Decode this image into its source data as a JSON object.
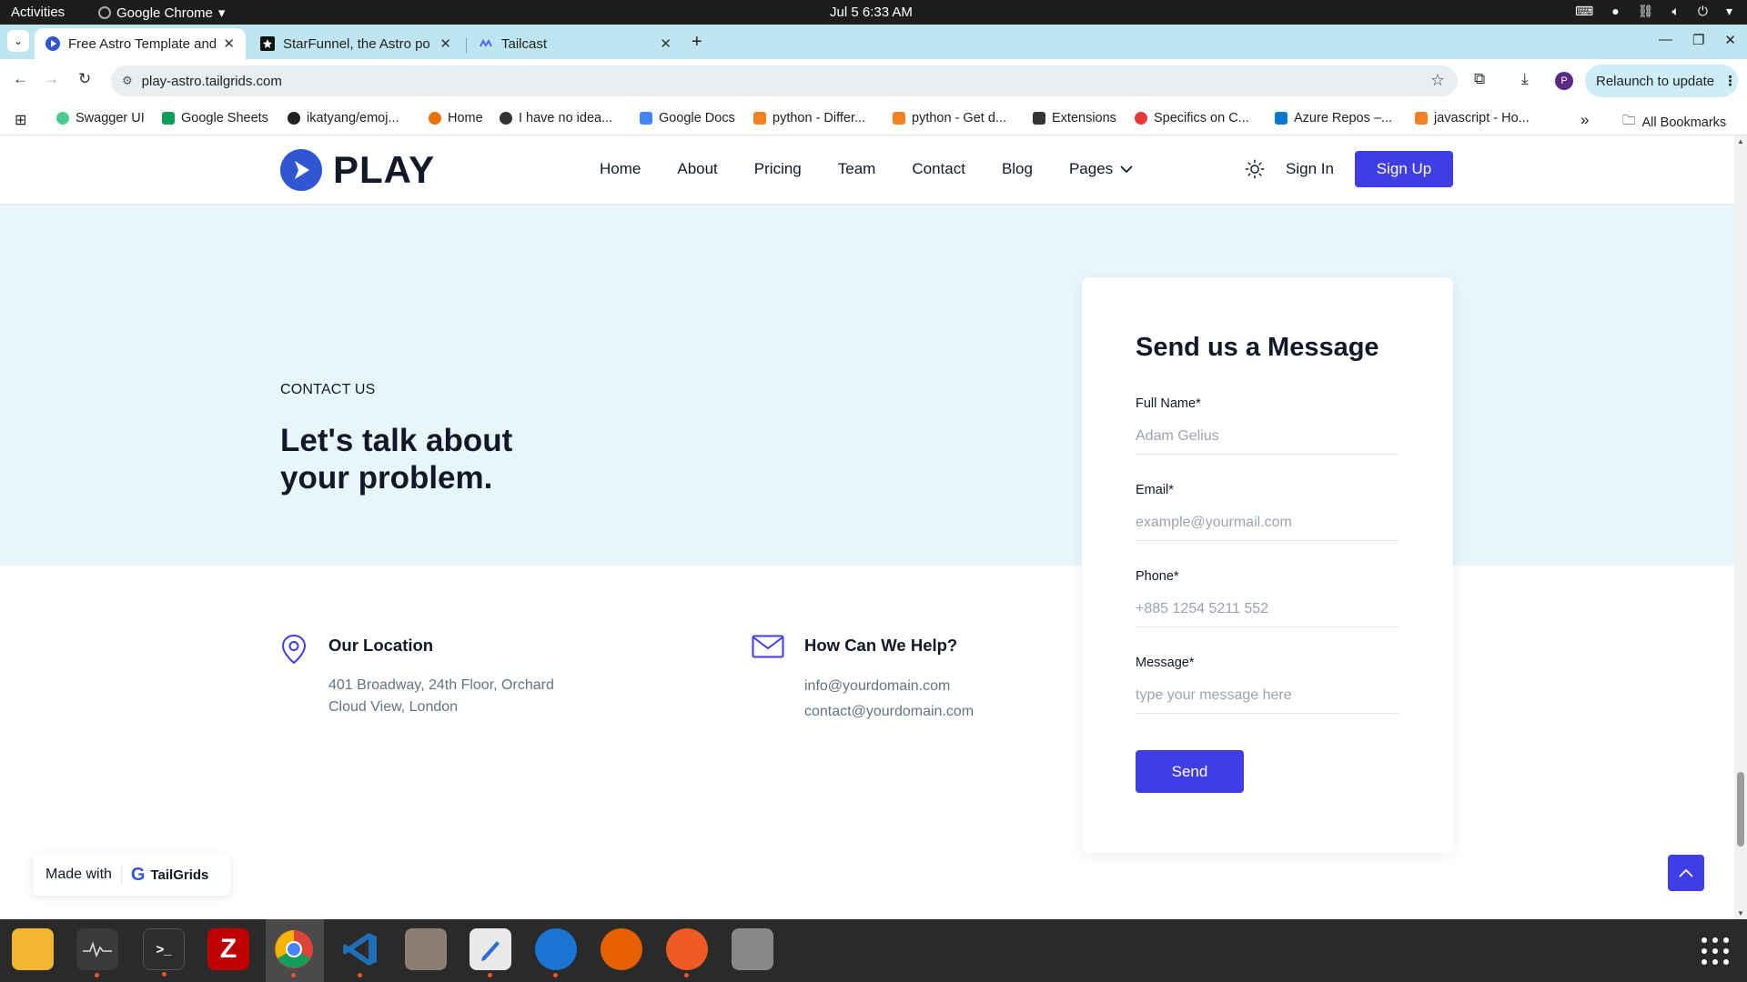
{
  "system_bar": {
    "activities": "Activities",
    "app_name": "Google Chrome",
    "clock": "Jul 5   6:33 AM"
  },
  "tabs": [
    {
      "title": "Free Astro Template and",
      "active": true
    },
    {
      "title": "StarFunnel, the Astro po",
      "active": false
    },
    {
      "title": "Tailcast",
      "active": false
    }
  ],
  "toolbar": {
    "url": "play-astro.tailgrids.com",
    "relaunch_label": "Relaunch to update",
    "profile_initial": "P"
  },
  "bookmarks": [
    {
      "label": "Swagger UI",
      "icon": "swagger-icon",
      "color": "#49cc90"
    },
    {
      "label": "Google Sheets",
      "icon": "sheets-icon",
      "color": "#0f9d58"
    },
    {
      "label": "ikatyang/emoj...",
      "icon": "github-icon",
      "color": "#222222"
    },
    {
      "label": "Home",
      "icon": "home-icon",
      "color": "#e8710a"
    },
    {
      "label": "I have no idea...",
      "icon": "globe-icon",
      "color": "#333333"
    },
    {
      "label": "Google Docs",
      "icon": "docs-icon",
      "color": "#4285f4"
    },
    {
      "label": "python - Differ...",
      "icon": "stackoverflow-icon",
      "color": "#f48024"
    },
    {
      "label": "python - Get d...",
      "icon": "stackoverflow-icon",
      "color": "#f48024"
    },
    {
      "label": "Extensions",
      "icon": "puzzle-icon",
      "color": "#333333"
    },
    {
      "label": "Specifics on C...",
      "icon": "asterisk-icon",
      "color": "#e53935"
    },
    {
      "label": "Azure Repos –...",
      "icon": "azure-icon",
      "color": "#0078d4"
    },
    {
      "label": "javascript - Ho...",
      "icon": "stackoverflow-icon",
      "color": "#f48024"
    }
  ],
  "bookmarks_overflow": "»",
  "all_bookmarks": "All Bookmarks",
  "site": {
    "logo_text": "PLAY",
    "nav": [
      "Home",
      "About",
      "Pricing",
      "Team",
      "Contact",
      "Blog",
      "Pages"
    ],
    "sign_in": "Sign In",
    "sign_up": "Sign Up",
    "accent_color": "#3f3de6"
  },
  "contact": {
    "eyebrow": "CONTACT US",
    "heading": "Let's talk about your problem.",
    "location": {
      "title": "Our Location",
      "line1": "401 Broadway, 24th Floor, Orchard",
      "line2": "Cloud View, London"
    },
    "help": {
      "title": "How Can We Help?",
      "email1": "info@yourdomain.com",
      "email2": "contact@yourdomain.com"
    }
  },
  "form": {
    "title": "Send us a Message",
    "full_name_label": "Full Name*",
    "full_name_placeholder": "Adam Gelius",
    "email_label": "Email*",
    "email_placeholder": "example@yourmail.com",
    "phone_label": "Phone*",
    "phone_placeholder": "+885 1254 5211 552",
    "message_label": "Message*",
    "message_placeholder": "type your message here",
    "send_label": "Send"
  },
  "made_with": {
    "prefix": "Made with",
    "brand": "TailGrids"
  },
  "dock": [
    {
      "name": "text-editor-notes",
      "color": "#f2b632"
    },
    {
      "name": "system-monitor",
      "color": "#3a3a3a"
    },
    {
      "name": "terminal",
      "color": "#2d2d2d"
    },
    {
      "name": "filezilla",
      "color": "#bf0000"
    },
    {
      "name": "google-chrome",
      "color": "#4a4a4a"
    },
    {
      "name": "vscode",
      "color": "#1f6fb5"
    },
    {
      "name": "files",
      "color": "#8a7f72"
    },
    {
      "name": "text-editor",
      "color": "#e9e9e9"
    },
    {
      "name": "thunderbird",
      "color": "#1a74d2"
    },
    {
      "name": "firefox",
      "color": "#e66000"
    },
    {
      "name": "postman",
      "color": "#ef5b25"
    },
    {
      "name": "disk-utility",
      "color": "#888888"
    }
  ]
}
